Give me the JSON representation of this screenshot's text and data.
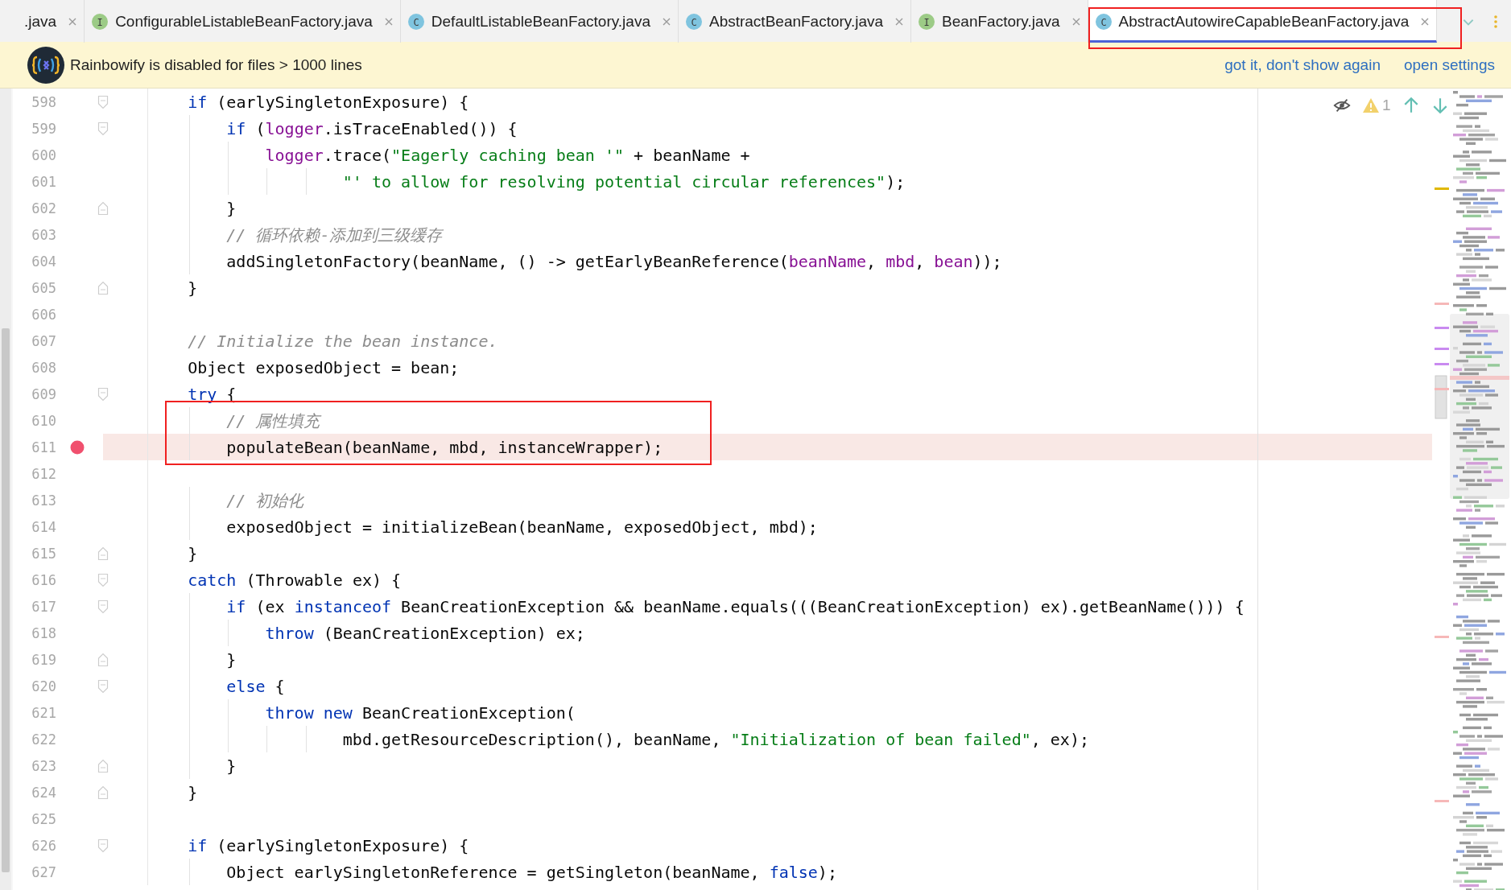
{
  "tabs": [
    {
      "label": ".java",
      "selected": false
    },
    {
      "label": "ConfigurableListableBeanFactory.java",
      "kind": "interface",
      "badge": "I",
      "selected": false
    },
    {
      "label": "DefaultListableBeanFactory.java",
      "kind": "class",
      "badge": "C",
      "selected": false
    },
    {
      "label": "AbstractBeanFactory.java",
      "kind": "class",
      "badge": "C",
      "selected": false
    },
    {
      "label": "BeanFactory.java",
      "kind": "interface",
      "badge": "I",
      "selected": false
    },
    {
      "label": "AbstractAutowireCapableBeanFactory.java",
      "kind": "class",
      "badge": "C",
      "selected": true
    }
  ],
  "banner": {
    "message": "Rainbowify is disabled for files > 1000 lines",
    "links": [
      "got it, don't show again",
      "open settings"
    ]
  },
  "inspections": {
    "warnings": "1"
  },
  "lines": [
    {
      "number": "598",
      "kind": "open",
      "breakpoint": false,
      "tokens": [
        {
          "kind": "kw",
          "text": "    if"
        },
        {
          "kind": "plain",
          "text": " (earlySingletonExposure) {"
        }
      ]
    },
    {
      "number": "599",
      "kind": "open",
      "breakpoint": false,
      "tokens": [
        {
          "kind": "kw",
          "text": "        if"
        },
        {
          "kind": "plain",
          "text": " ("
        },
        {
          "kind": "fld",
          "text": "logger"
        },
        {
          "kind": "plain",
          "text": ".isTraceEnabled()) {"
        }
      ]
    },
    {
      "number": "600",
      "breakpoint": false,
      "tokens": [
        {
          "kind": "fld",
          "text": "            logger"
        },
        {
          "kind": "plain",
          "text": ".trace("
        },
        {
          "kind": "str",
          "text": "\"Eagerly caching bean '\""
        },
        {
          "kind": "plain",
          "text": " + beanName +"
        }
      ]
    },
    {
      "number": "601",
      "breakpoint": false,
      "tokens": [
        {
          "kind": "str",
          "text": "                    \"' to allow for resolving potential circular references\""
        },
        {
          "kind": "plain",
          "text": ");"
        }
      ]
    },
    {
      "number": "602",
      "kind": "close",
      "breakpoint": false,
      "tokens": [
        {
          "kind": "plain",
          "text": "        }"
        }
      ]
    },
    {
      "number": "603",
      "breakpoint": false,
      "tokens": [
        {
          "kind": "cmt",
          "text": "        // 循环依赖-添加到三级缓存"
        }
      ]
    },
    {
      "number": "604",
      "breakpoint": false,
      "tokens": [
        {
          "kind": "plain",
          "text": "        addSingletonFactory(beanName, () -> getEarlyBeanReference("
        },
        {
          "kind": "fld",
          "text": "beanName"
        },
        {
          "kind": "plain",
          "text": ", "
        },
        {
          "kind": "fld",
          "text": "mbd"
        },
        {
          "kind": "plain",
          "text": ", "
        },
        {
          "kind": "fld",
          "text": "bean"
        },
        {
          "kind": "plain",
          "text": "));"
        }
      ]
    },
    {
      "number": "605",
      "kind": "close",
      "breakpoint": false,
      "tokens": [
        {
          "kind": "plain",
          "text": "    }"
        }
      ]
    },
    {
      "number": "606",
      "breakpoint": false
    },
    {
      "number": "607",
      "breakpoint": false,
      "tokens": [
        {
          "kind": "cmt",
          "text": "    // Initialize the bean instance."
        }
      ]
    },
    {
      "number": "608",
      "breakpoint": false,
      "tokens": [
        {
          "kind": "plain",
          "text": "    Object exposedObject = bean;"
        }
      ]
    },
    {
      "number": "609",
      "kind": "open",
      "breakpoint": false,
      "tokens": [
        {
          "kind": "kw",
          "text": "    try"
        },
        {
          "kind": "plain",
          "text": " {"
        }
      ]
    },
    {
      "number": "610",
      "breakpoint": false,
      "tokens": [
        {
          "kind": "cmt",
          "text": "        // 属性填充"
        }
      ]
    },
    {
      "number": "611",
      "breakpoint": true,
      "tokens": [
        {
          "kind": "plain",
          "text": "        populateBean(beanName, mbd, instanceWrapper);"
        }
      ]
    },
    {
      "number": "612",
      "breakpoint": false
    },
    {
      "number": "613",
      "breakpoint": false,
      "tokens": [
        {
          "kind": "cmt",
          "text": "        // 初始化"
        }
      ]
    },
    {
      "number": "614",
      "breakpoint": false,
      "tokens": [
        {
          "kind": "plain",
          "text": "        exposedObject = initializeBean(beanName, exposedObject, mbd);"
        }
      ]
    },
    {
      "number": "615",
      "kind": "close",
      "breakpoint": false,
      "tokens": [
        {
          "kind": "plain",
          "text": "    }"
        }
      ]
    },
    {
      "number": "616",
      "kind": "open",
      "breakpoint": false,
      "tokens": [
        {
          "kind": "kw",
          "text": "    catch"
        },
        {
          "kind": "plain",
          "text": " (Throwable ex) {"
        }
      ]
    },
    {
      "number": "617",
      "kind": "open",
      "breakpoint": false,
      "tokens": [
        {
          "kind": "kw",
          "text": "        if"
        },
        {
          "kind": "plain",
          "text": " (ex "
        },
        {
          "kind": "kw",
          "text": "instanceof"
        },
        {
          "kind": "plain",
          "text": " BeanCreationException && beanName.equals(((BeanCreationException) ex).getBeanName())) {"
        }
      ]
    },
    {
      "number": "618",
      "breakpoint": false,
      "tokens": [
        {
          "kind": "kw",
          "text": "            throw"
        },
        {
          "kind": "plain",
          "text": " (BeanCreationException) ex;"
        }
      ]
    },
    {
      "number": "619",
      "kind": "close",
      "breakpoint": false,
      "tokens": [
        {
          "kind": "plain",
          "text": "        }"
        }
      ]
    },
    {
      "number": "620",
      "kind": "open",
      "breakpoint": false,
      "tokens": [
        {
          "kind": "kw",
          "text": "        else"
        },
        {
          "kind": "plain",
          "text": " {"
        }
      ]
    },
    {
      "number": "621",
      "breakpoint": false,
      "tokens": [
        {
          "kind": "kw",
          "text": "            throw"
        },
        {
          "kind": "kw",
          "text": " new"
        },
        {
          "kind": "plain",
          "text": " BeanCreationException("
        }
      ]
    },
    {
      "number": "622",
      "breakpoint": false,
      "tokens": [
        {
          "kind": "plain",
          "text": "                    mbd.getResourceDescription(), beanName, "
        },
        {
          "kind": "str",
          "text": "\"Initialization of bean failed\""
        },
        {
          "kind": "plain",
          "text": ", ex);"
        }
      ]
    },
    {
      "number": "623",
      "kind": "close",
      "breakpoint": false,
      "tokens": [
        {
          "kind": "plain",
          "text": "        }"
        }
      ]
    },
    {
      "number": "624",
      "kind": "close",
      "breakpoint": false,
      "tokens": [
        {
          "kind": "plain",
          "text": "    }"
        }
      ]
    },
    {
      "number": "625",
      "breakpoint": false
    },
    {
      "number": "626",
      "kind": "open",
      "breakpoint": false,
      "tokens": [
        {
          "kind": "kw",
          "text": "    if"
        },
        {
          "kind": "plain",
          "text": " (earlySingletonExposure) {"
        }
      ]
    },
    {
      "number": "627",
      "breakpoint": false,
      "tokens": [
        {
          "kind": "plain",
          "text": "        Object earlySingletonReference = getSingleton(beanName, "
        },
        {
          "kind": "kw",
          "text": "false"
        },
        {
          "kind": "plain",
          "text": ");"
        }
      ]
    }
  ]
}
